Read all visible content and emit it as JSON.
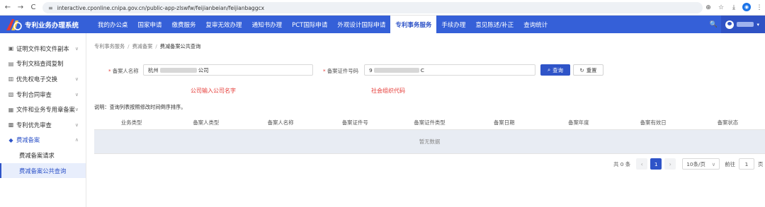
{
  "browser": {
    "url": "interactive.cponline.cnipa.gov.cn/public-app-zlswfw/feijianbeian/feijianbaggcx",
    "back_glyph": "←",
    "forward_glyph": "→",
    "reload_glyph": "C",
    "home_glyph": "⌂",
    "tune_glyph": "≡",
    "right_glyphs": [
      "⊕",
      "☆",
      "⤓",
      "◉",
      "⋮"
    ]
  },
  "header": {
    "title": "专利业务办理系统",
    "menu": [
      {
        "label": "我的办公桌",
        "active": false
      },
      {
        "label": "国家申请",
        "active": false
      },
      {
        "label": "缴费服务",
        "active": false
      },
      {
        "label": "复审无效办理",
        "active": false
      },
      {
        "label": "通知书办理",
        "active": false
      },
      {
        "label": "PCT国际申请",
        "active": false
      },
      {
        "label": "外观设计国际申请",
        "active": false
      },
      {
        "label": "专利事务服务",
        "active": true
      },
      {
        "label": "手续办理",
        "active": false
      },
      {
        "label": "意见陈述/补正",
        "active": false
      },
      {
        "label": "查询统计",
        "active": false
      }
    ],
    "search_glyph": "🔍",
    "user_chevron": "▾"
  },
  "sidebar": {
    "items": [
      {
        "label": "证明文件和文件副本",
        "icon": "▣",
        "chevron": "∨"
      },
      {
        "label": "专利文档查阅复制",
        "icon": "▤",
        "chevron": ""
      },
      {
        "label": "优先权电子交换",
        "icon": "▥",
        "chevron": "∨"
      },
      {
        "label": "专利合同审查",
        "icon": "▧",
        "chevron": "∨"
      },
      {
        "label": "文件和业务专用章备案",
        "icon": "▦",
        "chevron": "∨"
      },
      {
        "label": "专利优先审查",
        "icon": "▩",
        "chevron": "∨"
      },
      {
        "label": "费减备案",
        "icon": "◆",
        "chevron": "∧"
      }
    ],
    "subitems": [
      {
        "label": "费减备案请求",
        "active": false
      },
      {
        "label": "费减备案公共查询",
        "active": true
      }
    ]
  },
  "breadcrumb": {
    "items": [
      "专利事务服务",
      "费减备案"
    ],
    "current": "费减备案公共查询",
    "separator": "/"
  },
  "form": {
    "name_label": "备案人名称",
    "name_value_prefix": "杭州",
    "name_value_suffix": "公司",
    "cert_label": "备案证件号码",
    "cert_value_prefix": "9",
    "cert_value_suffix": "C",
    "required_mark": "*",
    "search_button": "查询",
    "search_icon": "⌕",
    "reset_button": "重置",
    "reset_icon": "↻"
  },
  "annotations": {
    "company_hint": "公司输入公司名字",
    "code_hint": "社会组织代码"
  },
  "description": "说明：查询列表按照修改时间倒序排序。",
  "table": {
    "columns": [
      "业务类型",
      "备案人类型",
      "备案人名称",
      "备案证件号",
      "备案证件类型",
      "备案日期",
      "备案年度",
      "备案有效日",
      "备案状态"
    ],
    "empty_text": "暂无数据"
  },
  "pagination": {
    "total_text": "共 0 条",
    "prev": "‹",
    "current_page": "1",
    "next": "›",
    "page_size": "10条/页",
    "page_size_chevron": "∨",
    "goto_label": "前往",
    "goto_value": "1",
    "page_unit": "页"
  },
  "colors": {
    "primary": "#2f54c8",
    "header_bg": "#3560d8",
    "annotation_red": "#e53935"
  }
}
